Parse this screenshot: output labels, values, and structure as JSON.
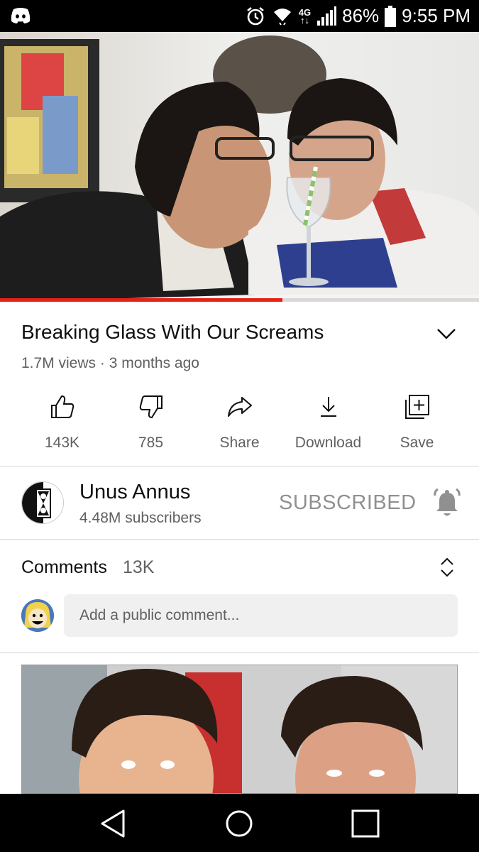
{
  "status_bar": {
    "app_icon": "discord-icon",
    "network": "4G",
    "battery": "86%",
    "time": "9:55 PM"
  },
  "video": {
    "progress": 0.59
  },
  "details": {
    "title": "Breaking Glass With Our Screams",
    "meta": "1.7M views · 3 months ago"
  },
  "actions": [
    {
      "icon": "thumbs-up-icon",
      "label": "143K"
    },
    {
      "icon": "thumbs-down-icon",
      "label": "785"
    },
    {
      "icon": "share-icon",
      "label": "Share"
    },
    {
      "icon": "download-icon",
      "label": "Download"
    },
    {
      "icon": "save-playlist-icon",
      "label": "Save"
    }
  ],
  "channel": {
    "name": "Unus Annus",
    "subscribers": "4.48M subscribers",
    "subscribe_state": "SUBSCRIBED"
  },
  "comments": {
    "title": "Comments",
    "count": "13K",
    "placeholder": "Add a public comment..."
  },
  "colors": {
    "progress": "#e62117",
    "secondary_text": "#606060",
    "subscribed_text": "#909090"
  }
}
